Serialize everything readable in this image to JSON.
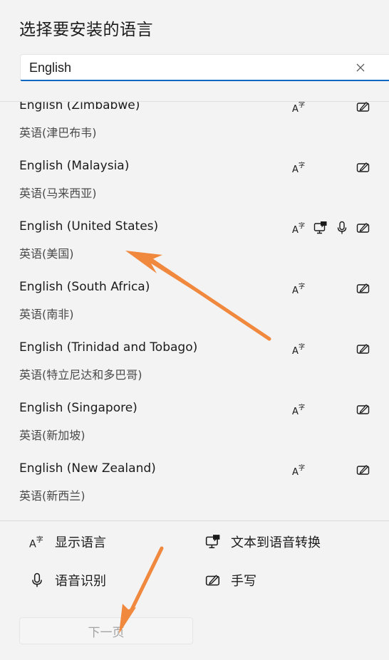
{
  "dialog": {
    "title": "选择要安装的语言"
  },
  "search": {
    "value": "English",
    "placeholder": ""
  },
  "languages": [
    {
      "name": "English (Zimbabwe)",
      "native": "英语(津巴布韦)",
      "features": [
        "display-language",
        "handwriting"
      ]
    },
    {
      "name": "English (Malaysia)",
      "native": "英语(马来西亚)",
      "features": [
        "display-language",
        "handwriting"
      ]
    },
    {
      "name": "English (United States)",
      "native": "英语(美国)",
      "features": [
        "display-language",
        "text-to-speech",
        "speech-recognition",
        "handwriting"
      ]
    },
    {
      "name": "English (South Africa)",
      "native": "英语(南非)",
      "features": [
        "display-language",
        "handwriting"
      ]
    },
    {
      "name": "English (Trinidad and Tobago)",
      "native": "英语(特立尼达和多巴哥)",
      "features": [
        "display-language",
        "handwriting"
      ]
    },
    {
      "name": "English (Singapore)",
      "native": "英语(新加坡)",
      "features": [
        "display-language",
        "handwriting"
      ]
    },
    {
      "name": "English (New Zealand)",
      "native": "英语(新西兰)",
      "features": [
        "display-language",
        "handwriting"
      ]
    }
  ],
  "legend": {
    "display_language": "显示语言",
    "text_to_speech": "文本到语音转换",
    "speech_recognition": "语音识别",
    "handwriting": "手写"
  },
  "footer": {
    "next_label": "下一页"
  },
  "colors": {
    "accent": "#0067c0",
    "annotation_arrow": "#f0883e"
  }
}
